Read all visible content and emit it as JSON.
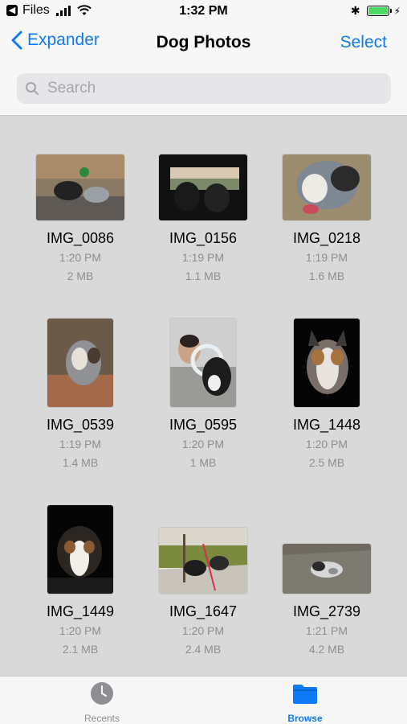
{
  "status_bar": {
    "app_back_label": "Files",
    "time": "1:32 PM",
    "icons": [
      "signal-icon",
      "wifi-icon",
      "bluetooth-icon",
      "battery-icon",
      "charging-icon"
    ],
    "battery_level": 1.0
  },
  "nav": {
    "back_label": "Expander",
    "title": "Dog Photos",
    "select_label": "Select"
  },
  "search": {
    "placeholder": "Search",
    "value": ""
  },
  "files": [
    {
      "name": "IMG_0086",
      "time": "1:20 PM",
      "size": "2 MB"
    },
    {
      "name": "IMG_0156",
      "time": "1:19 PM",
      "size": "1.1 MB"
    },
    {
      "name": "IMG_0218",
      "time": "1:19 PM",
      "size": "1.6 MB"
    },
    {
      "name": "IMG_0539",
      "time": "1:19 PM",
      "size": "1.4 MB"
    },
    {
      "name": "IMG_0595",
      "time": "1:20 PM",
      "size": "1 MB"
    },
    {
      "name": "IMG_1448",
      "time": "1:20 PM",
      "size": "2.5 MB"
    },
    {
      "name": "IMG_1449",
      "time": "1:20 PM",
      "size": "2.1 MB"
    },
    {
      "name": "IMG_1647",
      "time": "1:20 PM",
      "size": "2.4 MB"
    },
    {
      "name": "IMG_2739",
      "time": "1:21 PM",
      "size": "4.2 MB"
    }
  ],
  "tabs": [
    {
      "label": "Recents",
      "icon": "clock-icon",
      "selected": false
    },
    {
      "label": "Browse",
      "icon": "folder-icon",
      "selected": true
    }
  ],
  "colors": {
    "accent": "#0f7af6",
    "secondary_text": "#8e8e93",
    "battery": "#4cd964"
  }
}
